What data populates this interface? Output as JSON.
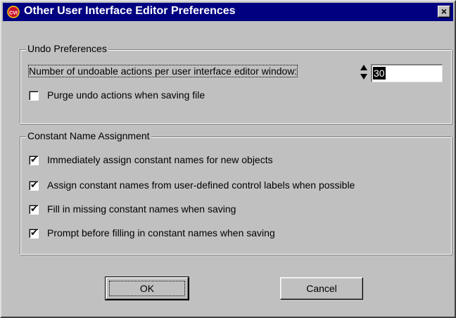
{
  "window": {
    "title": "Other User Interface Editor Preferences",
    "icon": "cvi-logo-icon",
    "close_label": "×"
  },
  "undo": {
    "group_label": "Undo Preferences",
    "actions_label": "Number of undoable actions per user interface editor window:",
    "actions_value": "30",
    "purge_label": "Purge undo actions when saving file",
    "purge_checked": false
  },
  "constants": {
    "group_label": "Constant Name Assignment",
    "options": [
      {
        "label": "Immediately assign constant names for new objects",
        "checked": true
      },
      {
        "label": "Assign constant names from user-defined control labels when possible",
        "checked": true
      },
      {
        "label": "Fill in missing constant names when saving",
        "checked": true
      },
      {
        "label": "Prompt before filling in constant names when saving",
        "checked": true
      }
    ]
  },
  "buttons": {
    "ok_label": "OK",
    "cancel_label": "Cancel"
  },
  "colors": {
    "titlebar": "#000080",
    "face": "#c0c0c0"
  }
}
